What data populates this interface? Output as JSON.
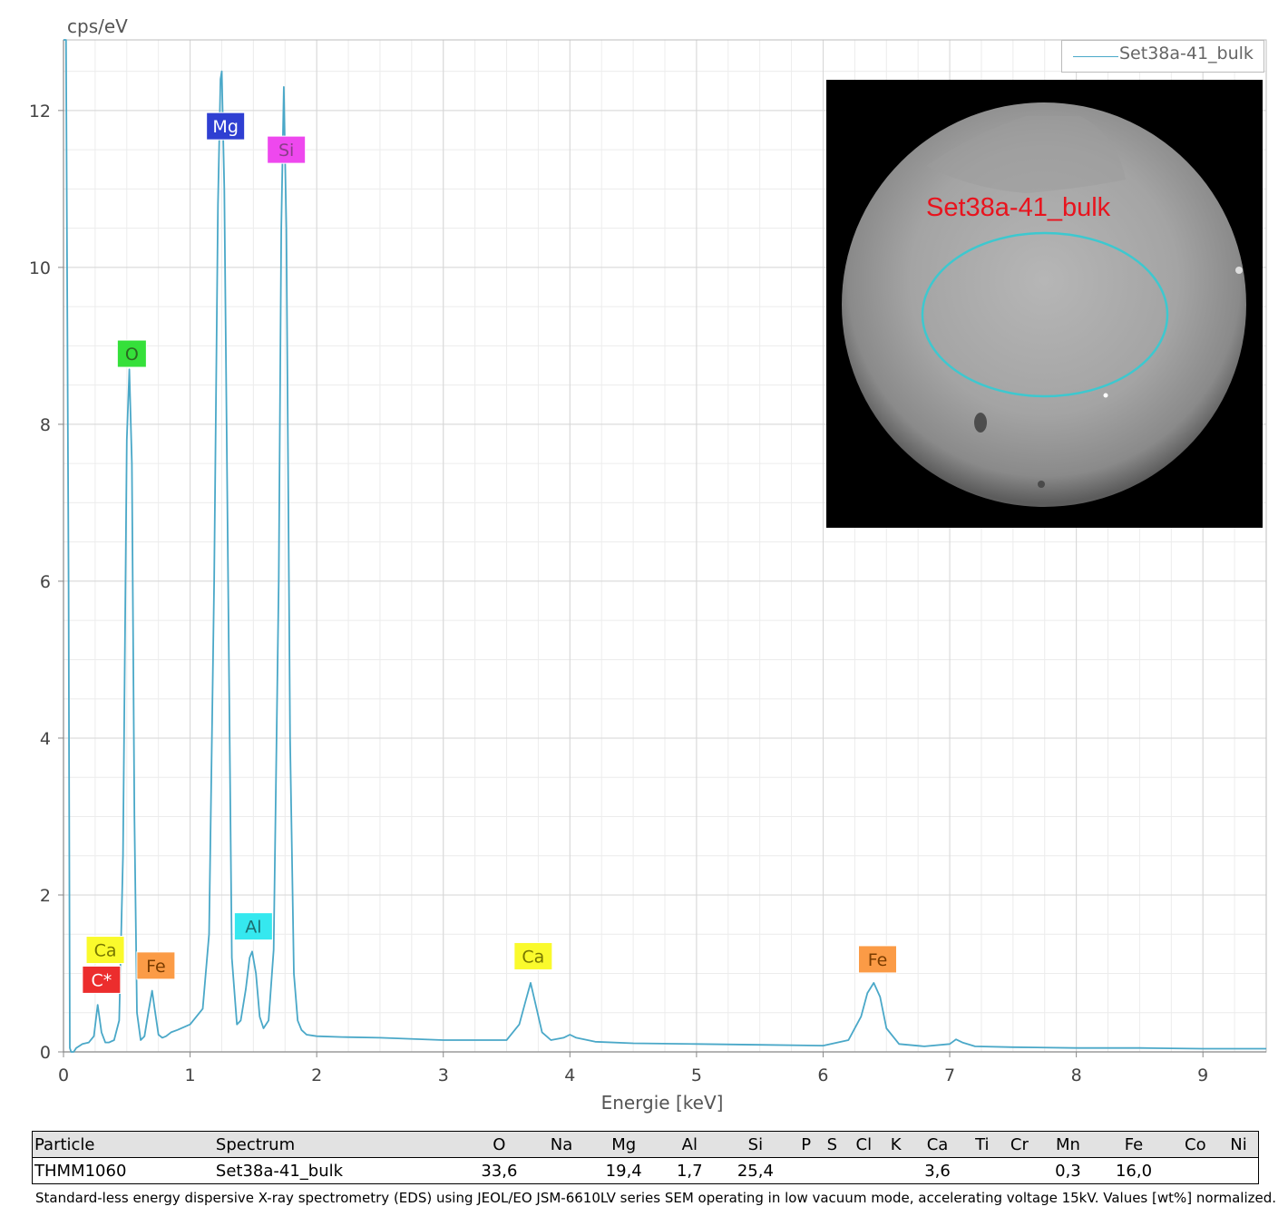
{
  "chart_data": {
    "type": "line",
    "ylabel": "cps/eV",
    "xlabel": "Energie [keV]",
    "xlim": [
      0,
      9.5
    ],
    "ylim": [
      0,
      12.9
    ],
    "x_ticks": [
      0,
      1,
      2,
      3,
      4,
      5,
      6,
      7,
      8,
      9
    ],
    "y_ticks": [
      0,
      2,
      4,
      6,
      8,
      10,
      12
    ],
    "grid": true,
    "legend_position": "top-right",
    "series": [
      {
        "name": "Set38a-41_bulk",
        "color": "#4aa8c8",
        "x": [
          0.0,
          0.02,
          0.04,
          0.05,
          0.06,
          0.08,
          0.1,
          0.15,
          0.2,
          0.24,
          0.27,
          0.3,
          0.33,
          0.36,
          0.4,
          0.44,
          0.47,
          0.5,
          0.52,
          0.54,
          0.56,
          0.58,
          0.61,
          0.64,
          0.67,
          0.7,
          0.72,
          0.75,
          0.78,
          0.81,
          0.85,
          0.9,
          1.0,
          1.1,
          1.15,
          1.19,
          1.22,
          1.24,
          1.25,
          1.27,
          1.3,
          1.33,
          1.37,
          1.4,
          1.44,
          1.47,
          1.49,
          1.52,
          1.55,
          1.58,
          1.62,
          1.66,
          1.7,
          1.72,
          1.74,
          1.76,
          1.79,
          1.82,
          1.85,
          1.88,
          1.92,
          2.0,
          2.2,
          2.5,
          3.0,
          3.5,
          3.6,
          3.65,
          3.69,
          3.73,
          3.78,
          3.85,
          3.95,
          4.0,
          4.05,
          4.2,
          4.5,
          5.0,
          5.5,
          6.0,
          6.2,
          6.3,
          6.35,
          6.4,
          6.45,
          6.5,
          6.6,
          6.8,
          7.0,
          7.05,
          7.1,
          7.2,
          7.5,
          8.0,
          8.5,
          9.0,
          9.5
        ],
        "y": [
          12.9,
          12.9,
          6.0,
          0.05,
          0.0,
          0.0,
          0.05,
          0.1,
          0.12,
          0.2,
          0.6,
          0.25,
          0.12,
          0.12,
          0.15,
          0.4,
          2.5,
          7.8,
          8.7,
          7.5,
          3.0,
          0.5,
          0.15,
          0.2,
          0.5,
          0.78,
          0.55,
          0.22,
          0.18,
          0.2,
          0.25,
          0.28,
          0.35,
          0.55,
          1.5,
          6.0,
          10.8,
          12.4,
          12.5,
          11.0,
          6.0,
          1.2,
          0.35,
          0.4,
          0.8,
          1.2,
          1.28,
          1.0,
          0.45,
          0.3,
          0.4,
          1.3,
          6.0,
          10.5,
          12.3,
          10.5,
          4.0,
          1.0,
          0.4,
          0.28,
          0.22,
          0.2,
          0.19,
          0.18,
          0.15,
          0.15,
          0.35,
          0.65,
          0.88,
          0.6,
          0.25,
          0.15,
          0.18,
          0.22,
          0.18,
          0.13,
          0.11,
          0.1,
          0.09,
          0.08,
          0.15,
          0.45,
          0.75,
          0.88,
          0.7,
          0.3,
          0.1,
          0.07,
          0.1,
          0.16,
          0.12,
          0.07,
          0.06,
          0.05,
          0.05,
          0.04,
          0.04
        ]
      }
    ],
    "peak_labels": [
      {
        "text": "Mg",
        "x": 1.28,
        "y": 11.8,
        "bg": "#2f3fd2",
        "fg": "#ffffff"
      },
      {
        "text": "Si",
        "x": 1.76,
        "y": 11.5,
        "bg": "#ee48ee",
        "fg": "#8a3d8a"
      },
      {
        "text": "O",
        "x": 0.54,
        "y": 8.9,
        "bg": "#35e03a",
        "fg": "#2a6a20"
      },
      {
        "text": "Ca",
        "x": 0.33,
        "y": 1.3,
        "bg": "#fafa2c",
        "fg": "#777700"
      },
      {
        "text": "C*",
        "x": 0.3,
        "y": 0.92,
        "bg": "#ec2d2d",
        "fg": "#ffffff"
      },
      {
        "text": "Fe",
        "x": 0.73,
        "y": 1.1,
        "bg": "#fb9b46",
        "fg": "#7a3c00"
      },
      {
        "text": "Al",
        "x": 1.5,
        "y": 1.6,
        "bg": "#35e8ef",
        "fg": "#1d6f72"
      },
      {
        "text": "Ca",
        "x": 3.71,
        "y": 1.22,
        "bg": "#fafa2c",
        "fg": "#777700"
      },
      {
        "text": "Fe",
        "x": 6.43,
        "y": 1.18,
        "bg": "#fb9b46",
        "fg": "#7a3c00"
      }
    ]
  },
  "inset": {
    "label": "Set38a-41_bulk",
    "ellipse_color": "#3dc8cf",
    "label_color": "#e8141e"
  },
  "table": {
    "headers": [
      "Particle",
      "Spectrum",
      "O",
      "Na",
      "Mg",
      "Al",
      "Si",
      "P",
      "S",
      "Cl",
      "K",
      "Ca",
      "Ti",
      "Cr",
      "Mn",
      "Fe",
      "Co",
      "Ni"
    ],
    "rows": [
      [
        "THMM1060",
        "Set38a-41_bulk",
        "33,6",
        "",
        "19,4",
        "1,7",
        "25,4",
        "",
        "",
        "",
        "",
        "3,6",
        "",
        "",
        "0,3",
        "16,0",
        "",
        ""
      ]
    ]
  },
  "caption": "Standard-less energy dispersive X-ray spectrometry (EDS) using JEOL/EO JSM-6610LV series SEM operating in low vacuum mode, accelerating voltage 15kV. Values [wt%] normalized."
}
